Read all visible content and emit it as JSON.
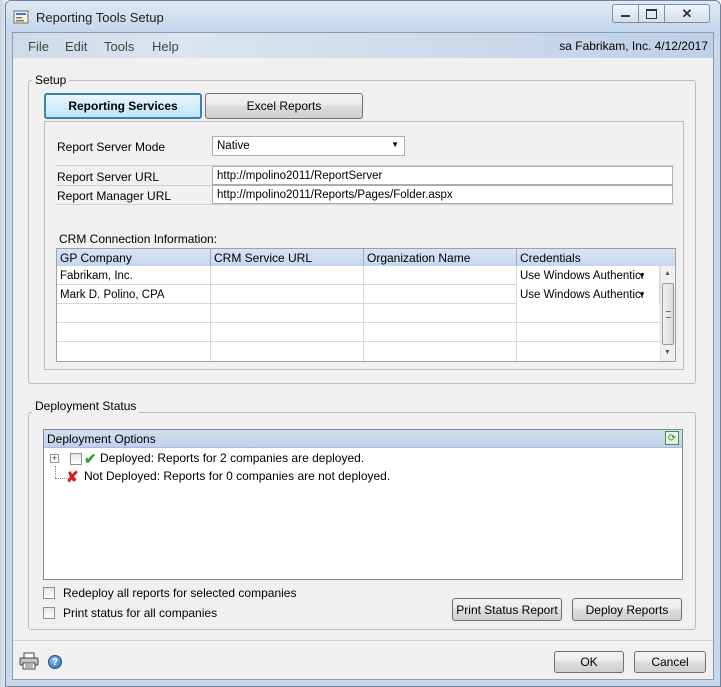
{
  "window": {
    "title": "Reporting Tools Setup"
  },
  "menu": {
    "items": [
      "File",
      "Edit",
      "Tools",
      "Help"
    ],
    "user_info": "sa  Fabrikam, Inc.  4/12/2017"
  },
  "setup": {
    "group_title": "Setup",
    "tabs": {
      "reporting_services": "Reporting Services",
      "excel_reports": "Excel Reports"
    },
    "report_server_mode": {
      "label": "Report Server Mode",
      "value": "Native"
    },
    "report_server_url": {
      "label": "Report Server URL",
      "value": "http://mpolino2011/ReportServer"
    },
    "report_manager_url": {
      "label": "Report Manager URL",
      "value": "http://mpolino2011/Reports/Pages/Folder.aspx"
    },
    "crm_label": "CRM Connection Information:",
    "crm_grid": {
      "columns": [
        "GP Company",
        "CRM Service URL",
        "Organization Name",
        "Credentials"
      ],
      "rows": [
        {
          "company": "Fabrikam, Inc.",
          "url": "",
          "org": "",
          "credentials": "Use Windows Authenticatio"
        },
        {
          "company": "Mark D. Polino, CPA",
          "url": "",
          "org": "",
          "credentials": "Use Windows Authenticatio"
        }
      ]
    }
  },
  "deployment": {
    "group_title": "Deployment Status",
    "options_header": "Deployment Options",
    "deployed_text": "Deployed: Reports for 2 companies are deployed.",
    "not_deployed_text": "Not Deployed: Reports for 0 companies are not deployed.",
    "redeploy_label": "Redeploy all reports for selected companies",
    "print_status_label": "Print status for all companies",
    "print_status_button": "Print Status Report",
    "deploy_button": "Deploy Reports"
  },
  "footer": {
    "ok_label": "OK",
    "cancel_label": "Cancel"
  },
  "colors": {
    "accent": "#3c7fb1",
    "success": "#2aa52a",
    "error": "#d81e1e",
    "header_blue": "#c6d7ee"
  }
}
